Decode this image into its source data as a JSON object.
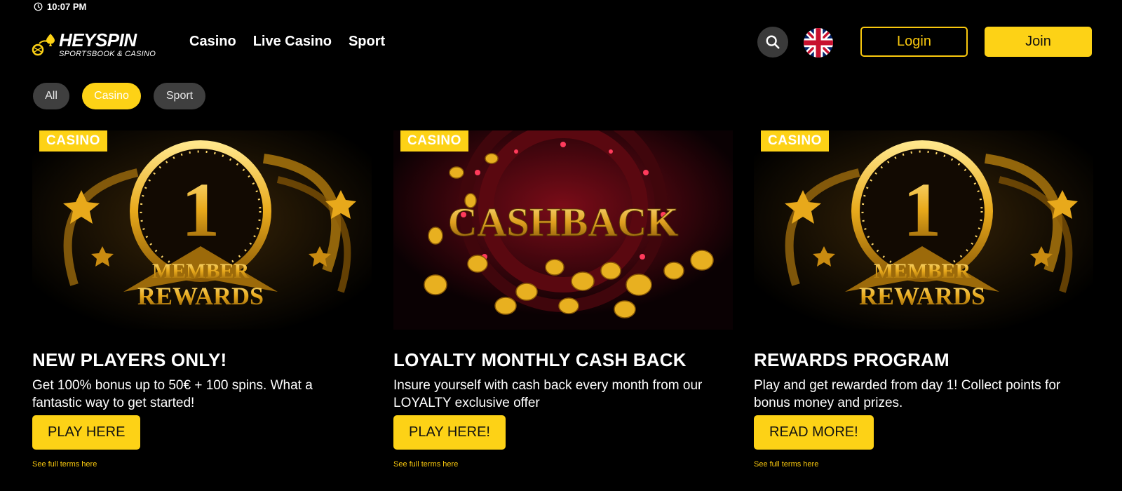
{
  "status": {
    "time": "10:07 PM"
  },
  "logo": {
    "main": "HEYSPIN",
    "sub": "SPORTSBOOK & CASINO"
  },
  "nav": {
    "items": [
      "Casino",
      "Live Casino",
      "Sport"
    ]
  },
  "header": {
    "login_label": "Login",
    "join_label": "Join"
  },
  "filters": {
    "items": [
      "All",
      "Casino",
      "Sport"
    ],
    "active": "Casino"
  },
  "cards": [
    {
      "badge": "CASINO",
      "image_text_number": "1",
      "image_text_1": "MEMBER",
      "image_text_2": "REWARDS",
      "title": "NEW PLAYERS ONLY!",
      "description": "Get 100% bonus up to 50€ + 100 spins. What a fantastic way to get started!",
      "cta": "PLAY HERE",
      "terms": "See full terms here"
    },
    {
      "badge": "CASINO",
      "image_text_1": "CASHBACK",
      "title": "LOYALTY MONTHLY CASH BACK",
      "description": "Insure yourself with cash back every month from our LOYALTY exclusive offer",
      "cta": "PLAY HERE!",
      "terms": "See full terms here"
    },
    {
      "badge": "CASINO",
      "image_text_number": "1",
      "image_text_1": "MEMBER",
      "image_text_2": "REWARDS",
      "title": "REWARDS PROGRAM",
      "description": "Play and get rewarded from day 1! Collect points for bonus money and prizes.",
      "cta": "READ MORE!",
      "terms": "See full terms here"
    }
  ],
  "colors": {
    "accent": "#fdd216",
    "background": "#000000",
    "chip": "#3f3f3f"
  },
  "icons": {
    "search": "search-icon",
    "flag": "uk-flag-icon",
    "clock": "clock-icon"
  }
}
